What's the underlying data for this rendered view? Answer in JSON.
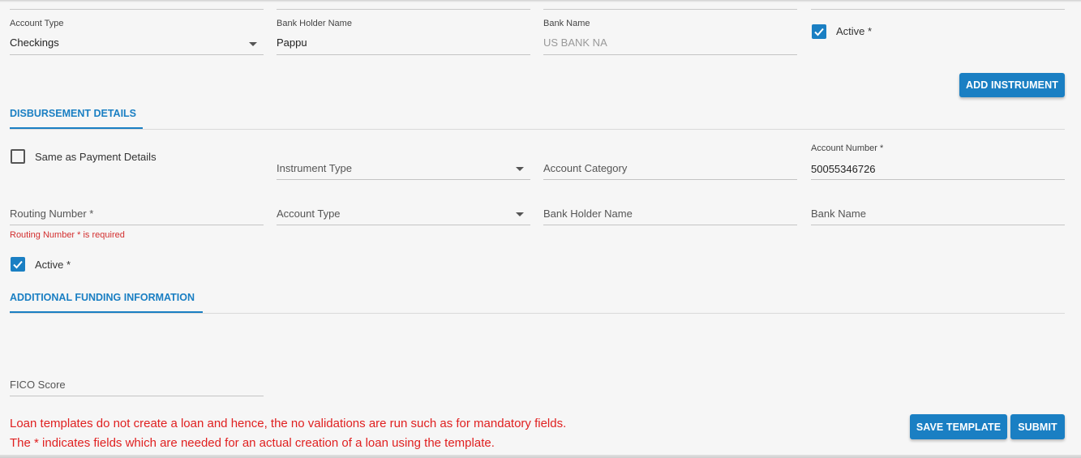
{
  "payment": {
    "account_type": {
      "label": "Account Type",
      "value": "Checkings"
    },
    "bank_holder_name": {
      "label": "Bank Holder Name",
      "value": "Pappu"
    },
    "bank_name": {
      "label": "Bank Name",
      "value": "US BANK NA"
    },
    "active": {
      "label": "Active *",
      "checked": true
    },
    "add_instrument_label": "ADD INSTRUMENT"
  },
  "disbursement": {
    "title": "DISBURSEMENT DETAILS",
    "same_as_payment": {
      "label": "Same as Payment Details",
      "checked": false
    },
    "instrument_type": {
      "placeholder": "Instrument Type"
    },
    "account_category": {
      "placeholder": "Account Category"
    },
    "account_number": {
      "label": "Account Number *",
      "value": "50055346726"
    },
    "routing_number": {
      "placeholder": "Routing Number *",
      "error": "Routing Number * is required"
    },
    "account_type": {
      "placeholder": "Account Type"
    },
    "bank_holder_name": {
      "placeholder": "Bank Holder Name"
    },
    "bank_name": {
      "placeholder": "Bank Name"
    },
    "active": {
      "label": "Active *",
      "checked": true
    }
  },
  "additional": {
    "title": "ADDITIONAL FUNDING INFORMATION",
    "fico_score": {
      "placeholder": "FICO Score"
    }
  },
  "notes": {
    "line1": "Loan templates do not create a loan and hence, the no validations are run such as for mandatory fields.",
    "line2": "The * indicates fields which are needed for an actual creation of a loan using the template."
  },
  "actions": {
    "save_template_label": "SAVE TEMPLATE",
    "submit_label": "SUBMIT"
  },
  "colors": {
    "accent": "#1a7fc3",
    "error": "#e02020",
    "background": "#f6f6f6"
  }
}
